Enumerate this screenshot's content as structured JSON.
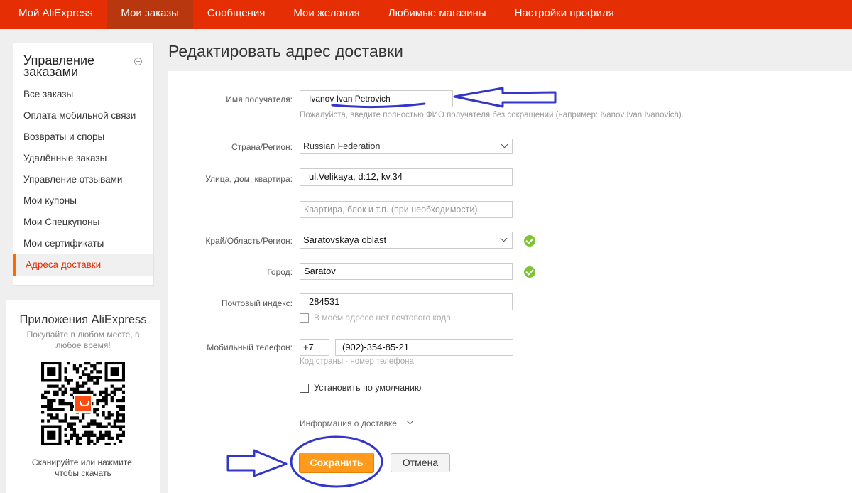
{
  "topnav": {
    "items": [
      "Мой AliExpress",
      "Мои заказы",
      "Сообщения",
      "Мои желания",
      "Любимые магазины",
      "Настройки профиля"
    ],
    "active_index": 1
  },
  "sidebar": {
    "title": "Управление заказами",
    "items": [
      "Все заказы",
      "Оплата мобильной связи",
      "Возвраты и споры",
      "Удалённые заказы",
      "Управление отзывами",
      "Мои купоны",
      "Мои Спецкупоны",
      "Мои сертификаты",
      "Адреса доставки"
    ],
    "active_index": 8
  },
  "apps": {
    "title": "Приложения AliExpress",
    "subtitle": "Покупайте в любом месте, в любое время!",
    "footer": "Сканируйте или нажмите, чтобы скачать"
  },
  "page": {
    "title": "Редактировать адрес доставки"
  },
  "form": {
    "recipient": {
      "label": "Имя получателя:",
      "value": "Ivanov Ivan Petrovich",
      "hint": "Пожалуйста, введите полностью ФИО получателя без сокращений (например: Ivanov Ivan Ivanovich)."
    },
    "country": {
      "label": "Страна/Регион:",
      "value": "Russian Federation"
    },
    "street": {
      "label": "Улица, дом, квартира:",
      "value": "ul.Velikaya, d:12, kv.34"
    },
    "apartment": {
      "placeholder": "Квартира, блок и т.п. (при необходимости)"
    },
    "region": {
      "label": "Край/Область/Регион:",
      "value": "Saratovskaya oblast"
    },
    "city": {
      "label": "Город:",
      "value": "Saratov"
    },
    "postal": {
      "label": "Почтовый индекс:",
      "value": "284531",
      "no_code_label": "В моём адресе нет почтового кода."
    },
    "phone": {
      "label": "Мобильный телефон:",
      "country_code": "+7",
      "number": "(902)-354-85-21",
      "hint": "Код страны - номер телефона"
    },
    "default_label": "Установить по умолчанию",
    "delivery_info": "Информация о доставке",
    "save": "Сохранить",
    "cancel": "Отмена"
  },
  "colors": {
    "nav_bg": "#e62e04",
    "nav_active": "#b8370f",
    "save_button": "#ff9a1c",
    "ok_icon": "#7ec534",
    "annotation": "#3236c9"
  },
  "icons": [
    "collapse-icon",
    "chevron-down-icon",
    "check-circle-icon",
    "qr-code-icon",
    "aliexpress-logo-icon"
  ]
}
